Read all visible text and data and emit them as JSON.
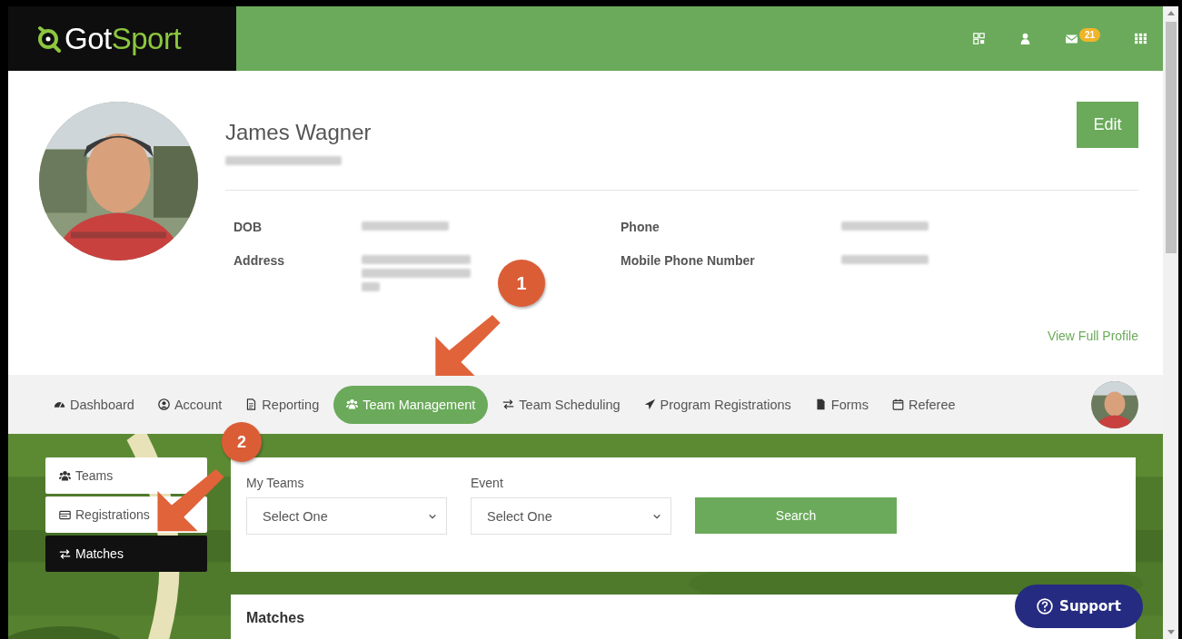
{
  "header": {
    "logo": {
      "parts": [
        "Got",
        "Sport"
      ]
    },
    "mail_badge": "21"
  },
  "profile": {
    "name": "James Wagner",
    "edit_button": "Edit",
    "fields": [
      {
        "label": "DOB"
      },
      {
        "label": "Phone"
      },
      {
        "label": "Address"
      },
      {
        "label": "Mobile Phone Number"
      }
    ],
    "link": "View Full Profile"
  },
  "nav": {
    "items": [
      {
        "label": "Dashboard",
        "selected": false
      },
      {
        "label": "Account",
        "selected": false
      },
      {
        "label": "Reporting",
        "selected": false
      },
      {
        "label": "Team Management",
        "selected": true
      },
      {
        "label": "Team Scheduling",
        "selected": false
      },
      {
        "label": "Program Registrations",
        "selected": false
      },
      {
        "label": "Forms",
        "selected": false
      },
      {
        "label": "Referee",
        "selected": false
      }
    ]
  },
  "side_menu": [
    {
      "label": "Teams",
      "selected": false
    },
    {
      "label": "Registrations",
      "selected": false
    },
    {
      "label": "Matches",
      "selected": true
    }
  ],
  "filters": {
    "fields": [
      {
        "label": "My Teams",
        "value": "Select One"
      },
      {
        "label": "Event",
        "value": "Select One"
      }
    ],
    "search_button": "Search"
  },
  "matches": {
    "title": "Matches"
  },
  "support_button": "Support",
  "callouts": [
    {
      "number": "1"
    },
    {
      "number": "2"
    }
  ]
}
